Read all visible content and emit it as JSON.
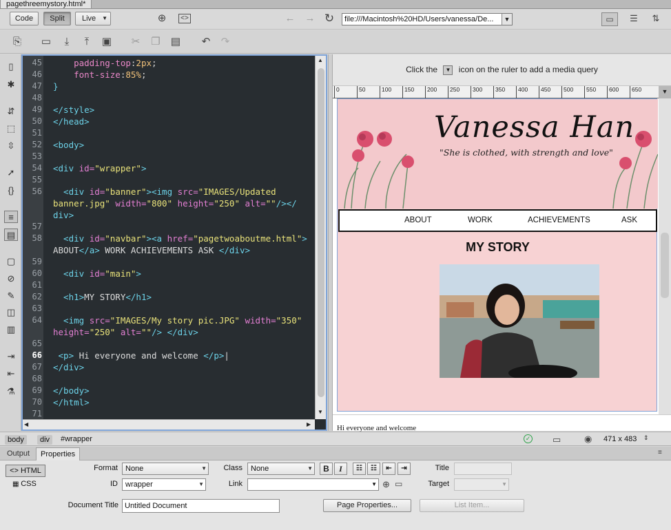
{
  "document_tab": {
    "filename": "pagethreemystory.html*"
  },
  "toolbar": {
    "code_label": "Code",
    "split_label": "Split",
    "live_label": "Live",
    "url": "file:///Macintosh%20HD/Users/vanessa/De..."
  },
  "code": {
    "lines": [
      {
        "num": "45",
        "parts": [
          {
            "c": "k",
            "t": "    padding-top"
          },
          {
            "c": "",
            "t": ":"
          },
          {
            "c": "n",
            "t": "2px"
          },
          {
            "c": "",
            "t": ";"
          }
        ]
      },
      {
        "num": "46",
        "parts": [
          {
            "c": "k",
            "t": "    font-size"
          },
          {
            "c": "",
            "t": ":"
          },
          {
            "c": "n",
            "t": "85%"
          },
          {
            "c": "",
            "t": ";"
          }
        ]
      },
      {
        "num": "47",
        "parts": [
          {
            "c": "t",
            "t": "}"
          }
        ]
      },
      {
        "num": "48",
        "parts": []
      },
      {
        "num": "49",
        "parts": [
          {
            "c": "t",
            "t": "</style>"
          }
        ]
      },
      {
        "num": "50",
        "parts": [
          {
            "c": "t",
            "t": "</head>"
          }
        ]
      },
      {
        "num": "51",
        "parts": []
      },
      {
        "num": "52",
        "parts": [
          {
            "c": "t",
            "t": "<body>"
          }
        ]
      },
      {
        "num": "53",
        "parts": []
      },
      {
        "num": "54",
        "parts": [
          {
            "c": "t",
            "t": "<div "
          },
          {
            "c": "a",
            "t": "id="
          },
          {
            "c": "s",
            "t": "\"wrapper\""
          },
          {
            "c": "t",
            "t": ">"
          }
        ]
      },
      {
        "num": "55",
        "parts": []
      },
      {
        "num": "56",
        "parts": [
          {
            "c": "t",
            "t": "  <div "
          },
          {
            "c": "a",
            "t": "id="
          },
          {
            "c": "s",
            "t": "\"banner\""
          },
          {
            "c": "t",
            "t": "><img "
          },
          {
            "c": "a",
            "t": "src="
          },
          {
            "c": "s",
            "t": "\"IMAGES/Updated"
          }
        ]
      },
      {
        "num": "",
        "parts": [
          {
            "c": "s",
            "t": "banner.jpg\""
          },
          {
            "c": "a",
            "t": " width="
          },
          {
            "c": "s",
            "t": "\"800\""
          },
          {
            "c": "a",
            "t": " height="
          },
          {
            "c": "s",
            "t": "\"250\""
          },
          {
            "c": "a",
            "t": " alt="
          },
          {
            "c": "s",
            "t": "\"\""
          },
          {
            "c": "t",
            "t": "/></"
          }
        ]
      },
      {
        "num": "",
        "parts": [
          {
            "c": "t",
            "t": "div>"
          }
        ]
      },
      {
        "num": "57",
        "parts": []
      },
      {
        "num": "58",
        "parts": [
          {
            "c": "t",
            "t": "  <div "
          },
          {
            "c": "a",
            "t": "id="
          },
          {
            "c": "s",
            "t": "\"navbar\""
          },
          {
            "c": "t",
            "t": "><a "
          },
          {
            "c": "a",
            "t": "href="
          },
          {
            "c": "s",
            "t": "\"pagetwoaboutme.html\""
          },
          {
            "c": "t",
            "t": ">"
          }
        ]
      },
      {
        "num": "",
        "parts": [
          {
            "c": "",
            "t": "ABOUT"
          },
          {
            "c": "t",
            "t": "</a>"
          },
          {
            "c": "",
            "t": " WORK ACHIEVEMENTS ASK "
          },
          {
            "c": "t",
            "t": "</div>"
          }
        ]
      },
      {
        "num": "59",
        "parts": []
      },
      {
        "num": "60",
        "parts": [
          {
            "c": "t",
            "t": "  <div "
          },
          {
            "c": "a",
            "t": "id="
          },
          {
            "c": "s",
            "t": "\"main\""
          },
          {
            "c": "t",
            "t": ">"
          }
        ]
      },
      {
        "num": "61",
        "parts": []
      },
      {
        "num": "62",
        "parts": [
          {
            "c": "t",
            "t": "  <h1>"
          },
          {
            "c": "",
            "t": "MY STORY"
          },
          {
            "c": "t",
            "t": "</h1>"
          }
        ]
      },
      {
        "num": "63",
        "parts": []
      },
      {
        "num": "64",
        "parts": [
          {
            "c": "t",
            "t": "  <img "
          },
          {
            "c": "a",
            "t": "src="
          },
          {
            "c": "s",
            "t": "\"IMAGES/My story pic.JPG\""
          },
          {
            "c": "a",
            "t": " width="
          },
          {
            "c": "s",
            "t": "\"350\""
          }
        ]
      },
      {
        "num": "",
        "parts": [
          {
            "c": "a",
            "t": "height="
          },
          {
            "c": "s",
            "t": "\"250\""
          },
          {
            "c": "a",
            "t": " alt="
          },
          {
            "c": "s",
            "t": "\"\""
          },
          {
            "c": "t",
            "t": "/> </div>"
          }
        ]
      },
      {
        "num": "65",
        "parts": []
      },
      {
        "num": "66",
        "cur": true,
        "parts": [
          {
            "c": "t",
            "t": " <p>"
          },
          {
            "c": "",
            "t": " Hi everyone and welcome "
          },
          {
            "c": "t",
            "t": "</p>"
          },
          {
            "c": "",
            "t": "|"
          }
        ]
      },
      {
        "num": "67",
        "parts": [
          {
            "c": "t",
            "t": "</div>"
          }
        ]
      },
      {
        "num": "68",
        "parts": []
      },
      {
        "num": "69",
        "parts": [
          {
            "c": "t",
            "t": "</body>"
          }
        ]
      },
      {
        "num": "70",
        "parts": [
          {
            "c": "t",
            "t": "</html>"
          }
        ]
      },
      {
        "num": "71",
        "parts": []
      }
    ]
  },
  "live": {
    "media_query_hint_before": "Click the",
    "media_query_hint_after": "icon on the ruler to add a media query",
    "ruler_ticks": [
      "0",
      "50",
      "100",
      "150",
      "200",
      "250",
      "300",
      "350",
      "400",
      "450",
      "500",
      "550",
      "600",
      "650"
    ],
    "banner_name": "Vanessa Han",
    "banner_tagline": "\"She is clothed, with strength and love\"",
    "nav": [
      "ABOUT",
      "WORK",
      "ACHIEVEMENTS",
      "ASK"
    ],
    "heading": "MY STORY",
    "paragraph": "Hi everyone and welcome"
  },
  "status": {
    "crumbs": [
      "body",
      "div",
      "#wrapper"
    ],
    "size": "471 x 483"
  },
  "panel": {
    "tabs": [
      "Output",
      "Properties"
    ],
    "html_label": "HTML",
    "css_label": "CSS",
    "format_label": "Format",
    "format_value": "None",
    "class_label": "Class",
    "class_value": "None",
    "title_label": "Title",
    "id_label": "ID",
    "id_value": "wrapper",
    "link_label": "Link",
    "target_label": "Target",
    "doc_title_label": "Document Title",
    "doc_title_value": "Untitled Document",
    "page_props_label": "Page Properties...",
    "list_item_label": "List Item..."
  },
  "colors": {
    "code_bg": "#282d31",
    "page_pink": "#f7d2d3",
    "selection_blue": "#7fa4d8"
  }
}
